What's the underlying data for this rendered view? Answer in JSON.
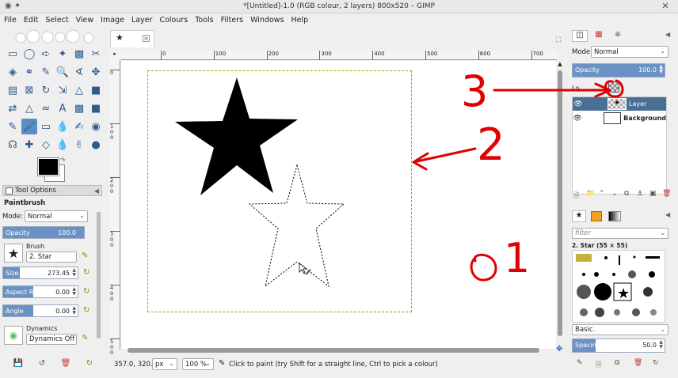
{
  "window": {
    "title": "*[Untitled]-1.0 (RGB colour, 2 layers) 800x520 – GIMP"
  },
  "menu": [
    "File",
    "Edit",
    "Select",
    "View",
    "Image",
    "Layer",
    "Colours",
    "Tools",
    "Filters",
    "Windows",
    "Help"
  ],
  "toolbox": {
    "tools": [
      "rect-select-icon",
      "ellipse-select-icon",
      "free-select-icon",
      "fuzzy-select-icon",
      "color-select-icon",
      "scissors-icon",
      "foreground-select-icon",
      "paths-icon",
      "color-picker-icon",
      "zoom-icon",
      "measure-icon",
      "move-icon",
      "align-icon",
      "crop-icon",
      "rotate-icon",
      "scale-icon",
      "shear-icon",
      "perspective-icon",
      "flip-icon",
      "cage-icon",
      "warp-icon",
      "text-icon",
      "bucket-fill-icon",
      "blend-icon",
      "pencil-icon",
      "paintbrush-icon",
      "eraser-icon",
      "airbrush-icon",
      "ink-icon",
      "mypaint-icon",
      "clone-icon",
      "heal-icon",
      "perspective-clone-icon",
      "blur-icon",
      "smudge-icon",
      "dodge-icon"
    ]
  },
  "colors": {
    "foreground": "#000000",
    "background": "#ffffff",
    "selected_tool_bg": "#5b8dc5",
    "accent": "#6a92c4",
    "annotation": "#e00000"
  },
  "tool_options": {
    "tab_label": "Tool Options",
    "tool_name": "Paintbrush",
    "mode_label": "Mode:",
    "mode_value": "Normal",
    "opacity_label": "Opacity",
    "opacity_value": "100.0",
    "brush_label": "Brush",
    "brush_value": "2. Star",
    "size_label": "Size",
    "size_value": "273.45",
    "aspect_label": "Aspect Ratio",
    "aspect_value": "0.00",
    "angle_label": "Angle",
    "angle_value": "0.00",
    "dynamics_label": "Dynamics",
    "dynamics_value": "Dynamics Off"
  },
  "canvas": {
    "ruler_labels": [
      "0",
      "100",
      "200",
      "300",
      "400",
      "500",
      "600",
      "700"
    ],
    "vruler_labels": [
      "0",
      "100",
      "200",
      "300",
      "400",
      "500"
    ]
  },
  "status": {
    "coords": "357.0, 320.0",
    "unit": "px",
    "zoom": "100 %",
    "message": "Click to paint (try Shift for a straight line, Ctrl to pick a colour)"
  },
  "layers": {
    "mode_label": "Mode:",
    "mode_value": "Normal",
    "opacity_label": "Opacity",
    "opacity_value": "100.0",
    "lock_label": "Lo",
    "items": [
      {
        "name": "Layer",
        "selected": true
      },
      {
        "name": "Background",
        "selected": false
      }
    ]
  },
  "brushes": {
    "filter_placeholder": "filter",
    "selected_brush": "2. Star (55 × 55)",
    "preset": "Basic.",
    "spacing_label": "Spacing",
    "spacing_value": "50.0"
  },
  "annotations": [
    "1",
    "2",
    "3"
  ]
}
